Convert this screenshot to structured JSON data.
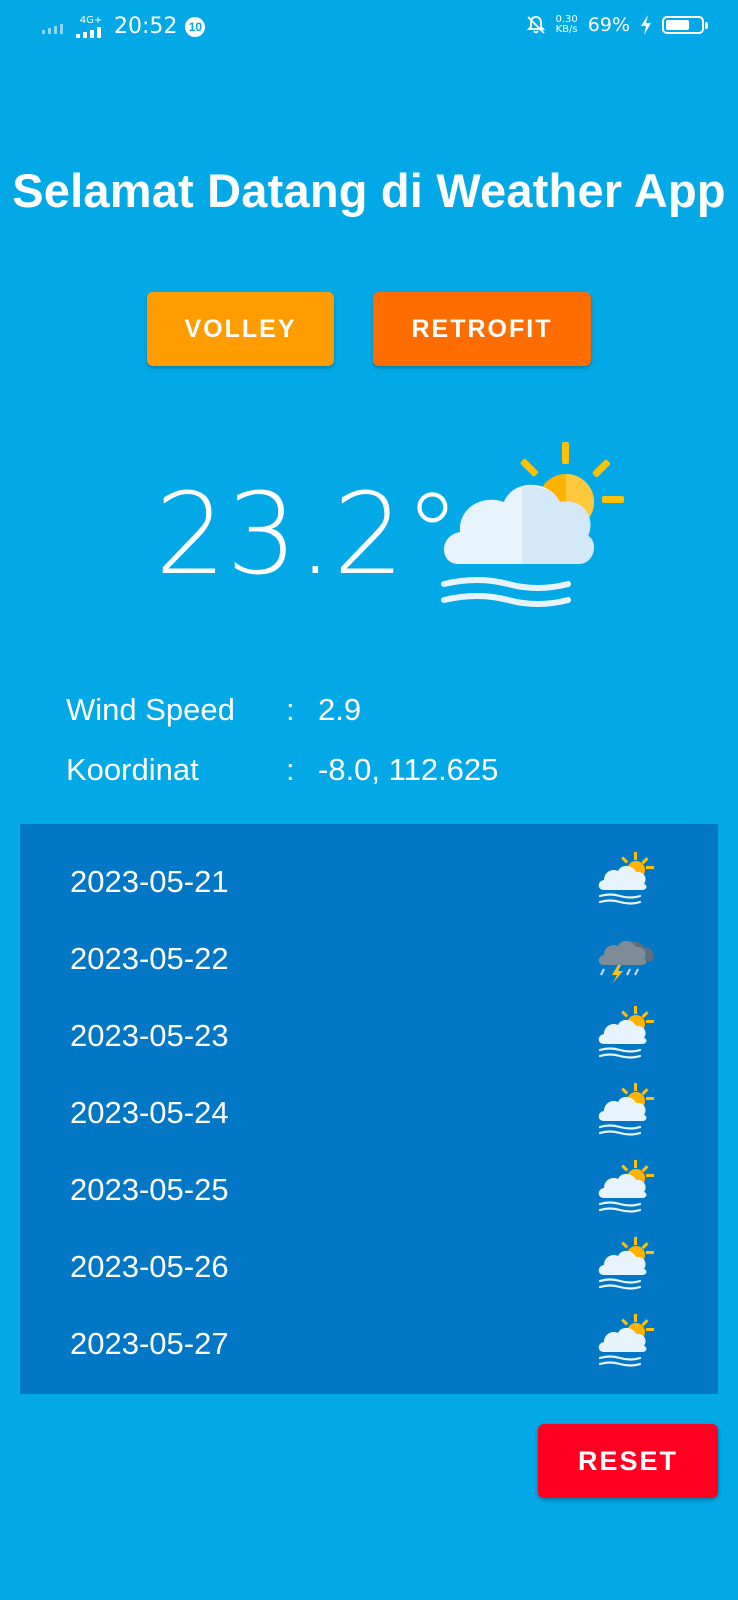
{
  "status_bar": {
    "network": "4G+",
    "time": "20:52",
    "notification_count": "10",
    "speed_value": "0.30",
    "speed_unit": "KB/s",
    "battery_percent": "69%",
    "battery_level": 0.69
  },
  "title": "Selamat Datang di Weather App",
  "buttons": {
    "volley": "VOLLEY",
    "retrofit": "RETROFIT",
    "reset": "RESET"
  },
  "current": {
    "temperature": "23.2°",
    "icon": "partly-cloudy-wind-icon",
    "wind_label": "Wind Speed",
    "wind_colon": ":",
    "wind_value": "2.9",
    "coord_label": "Koordinat",
    "coord_colon": ":",
    "coord_value": "-8.0, 112.625"
  },
  "forecast": [
    {
      "date": "2023-05-21",
      "icon": "partly-cloudy-wind-icon"
    },
    {
      "date": "2023-05-22",
      "icon": "thunderstorm-icon"
    },
    {
      "date": "2023-05-23",
      "icon": "partly-cloudy-wind-icon"
    },
    {
      "date": "2023-05-24",
      "icon": "partly-cloudy-wind-icon"
    },
    {
      "date": "2023-05-25",
      "icon": "partly-cloudy-wind-icon"
    },
    {
      "date": "2023-05-26",
      "icon": "partly-cloudy-wind-icon"
    },
    {
      "date": "2023-05-27",
      "icon": "partly-cloudy-wind-icon"
    }
  ],
  "colors": {
    "background": "#03A9E6",
    "forecast_panel": "#0277C6",
    "volley": "#FF9D00",
    "retrofit": "#FF6D00",
    "reset": "#FF0020"
  }
}
